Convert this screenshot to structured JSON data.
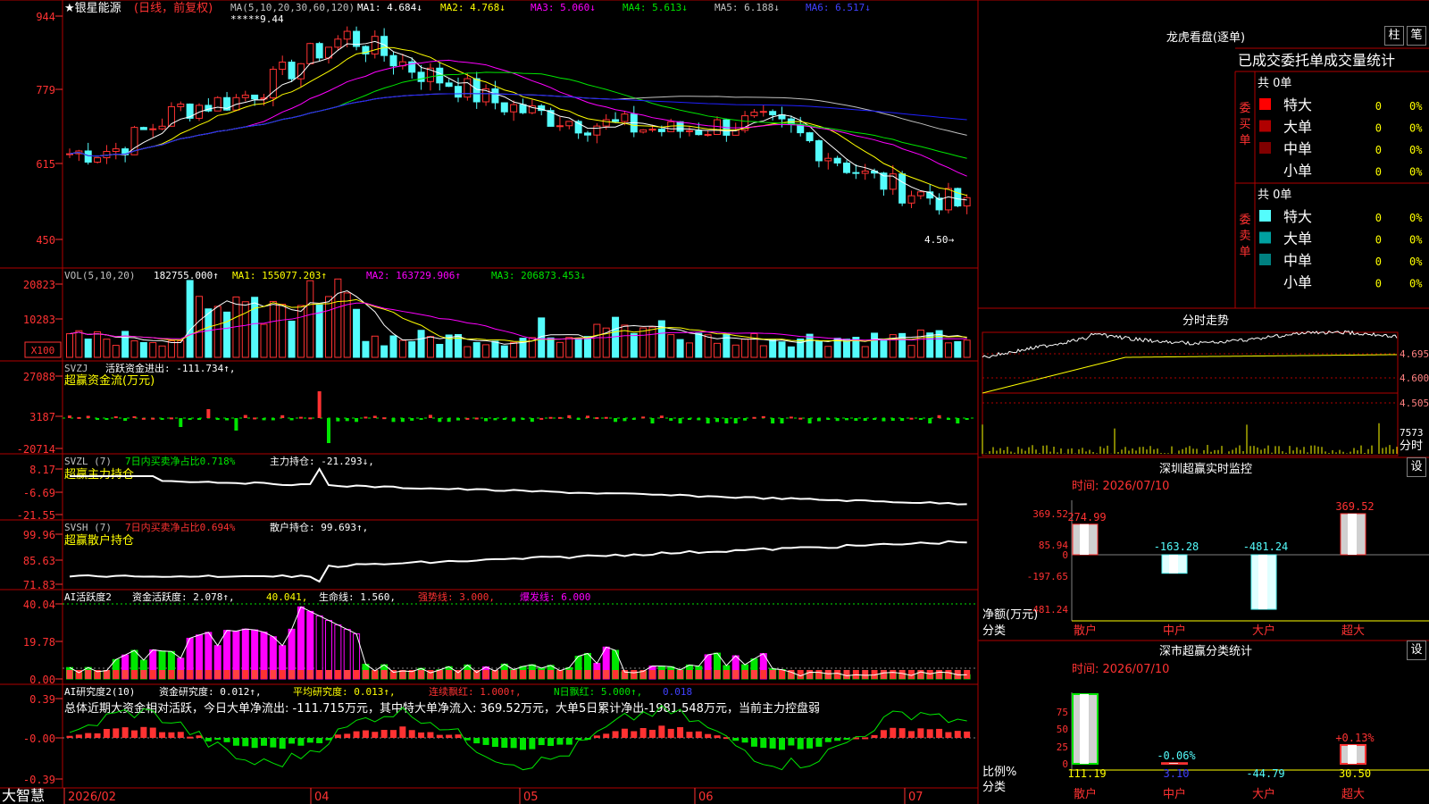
{
  "title": {
    "star": "★",
    "name": "银星能源",
    "mode": "(日线，前复权)",
    "ma_label": "MA(5,10,20,30,60,120)",
    "ma1": "MA1: 4.684",
    "ma2": "MA2: 4.768",
    "ma3": "MA3: 5.060",
    "ma4": "MA4: 5.613",
    "ma5": "MA5: 6.188",
    "ma6": "MA6: 6.517",
    "peak_marker": "*****9.44",
    "low_marker": "4.50→"
  },
  "price_axis": [
    "944",
    "779",
    "615",
    "450"
  ],
  "vol": {
    "label": "VOL(5,10,20)",
    "val": "182755.000",
    "ma1": "MA1: 155077.203",
    "ma2": "MA2: 163729.906",
    "ma3": "MA3: 206873.453",
    "axis": [
      "20823",
      "10283"
    ],
    "unit": "X100"
  },
  "svzj": {
    "label": "SVZJ",
    "desc": "活跃资金进出: -111.734",
    "sub": "超赢资金流(万元)",
    "axis": [
      "27088",
      "3187",
      "-20714"
    ]
  },
  "svzl": {
    "label": "SVZL (7)",
    "desc": "7日内买卖净占比0.718%",
    "hold": "主力持仓: -21.293",
    "sub": "超赢主力持仓",
    "axis": [
      "8.17",
      "-6.69",
      "-21.55"
    ]
  },
  "svsh": {
    "label": "SVSH (7)",
    "desc": "7日内买卖净占比0.694%",
    "hold": "散户持仓: 99.693",
    "sub": "超赢散户持仓",
    "axis": [
      "99.96",
      "85.63",
      "71.83"
    ]
  },
  "ai1": {
    "label": "AI活跃度2",
    "a": "资金活跃度: 2.078",
    "b": "40.041",
    "c": "生命线: 1.560",
    "d": "强势线: 3.000",
    "e": "爆发线: 6.000",
    "axis": [
      "40.04",
      "19.78",
      "0.00"
    ]
  },
  "ai2": {
    "label": "AI研究度2(10)",
    "a": "资金研究度: 0.012",
    "b": "平均研究度: 0.013",
    "c": "连续飘红: 1.000",
    "d": "N日飘红: 5.000",
    "e": "0.018",
    "summary": "总体近期大资金相对活跃，今日大单净流出: -111.715万元，其中特大单净流入: 369.52万元，大单5日累计净出-1981.548万元，当前主力控盘弱",
    "axis": [
      "0.39",
      "-0.00",
      "-0.39"
    ]
  },
  "date_axis": [
    "2026/02",
    "04",
    "05",
    "06",
    "07"
  ],
  "logo": "大智慧",
  "lhb": {
    "title": "龙虎看盘(逐单)",
    "btn1": "柱",
    "btn2": "笔",
    "header": "已成交委托单成交量统计",
    "buy_label": "委买单",
    "sell_label": "委卖单",
    "buy_total": "共 0单",
    "sell_total": "共 0单",
    "rows": [
      {
        "name": "特大",
        "n": "0",
        "p": "0%"
      },
      {
        "name": "大单",
        "n": "0",
        "p": "0%"
      },
      {
        "name": "中单",
        "n": "0",
        "p": "0%"
      },
      {
        "name": "小单",
        "n": "0",
        "p": "0%"
      }
    ]
  },
  "fenshi": {
    "title": "分时走势",
    "axis": [
      "4.695",
      "4.600",
      "4.505"
    ],
    "vol": "7573",
    "unit": "分时"
  },
  "sz_monitor": {
    "title": "深圳超赢实时监控",
    "btn": "设",
    "time": "时间: 2026/07/10",
    "axis": [
      "369.52",
      "85.94",
      "0",
      "-197.65",
      "-481.24"
    ],
    "ylabel1": "净额(万元)",
    "ylabel2": "分类",
    "bars": [
      {
        "cat": "散户",
        "val": "274.99",
        "v": 274.99
      },
      {
        "cat": "中户",
        "val": "-163.28",
        "v": -163.28
      },
      {
        "cat": "大户",
        "val": "-481.24",
        "v": -481.24
      },
      {
        "cat": "超大",
        "val": "369.52",
        "v": 369.52
      }
    ]
  },
  "sz_class": {
    "title": "深市超赢分类统计",
    "btn": "设",
    "time": "时间: 2026/07/10",
    "axis": [
      "75",
      "50",
      "25",
      "0"
    ],
    "ylabel1": "比例%",
    "ylabel2": "分类",
    "bars": [
      {
        "cat": "散户",
        "pct": "",
        "val": "111.19",
        "v": 100
      },
      {
        "cat": "中户",
        "pct": "-0.06%",
        "val": "3.10",
        "v": 1
      },
      {
        "cat": "大户",
        "pct": "",
        "val": "-44.79",
        "v": 0
      },
      {
        "cat": "超大",
        "pct": "+0.13%",
        "val": "30.50",
        "v": 27
      }
    ]
  }
}
